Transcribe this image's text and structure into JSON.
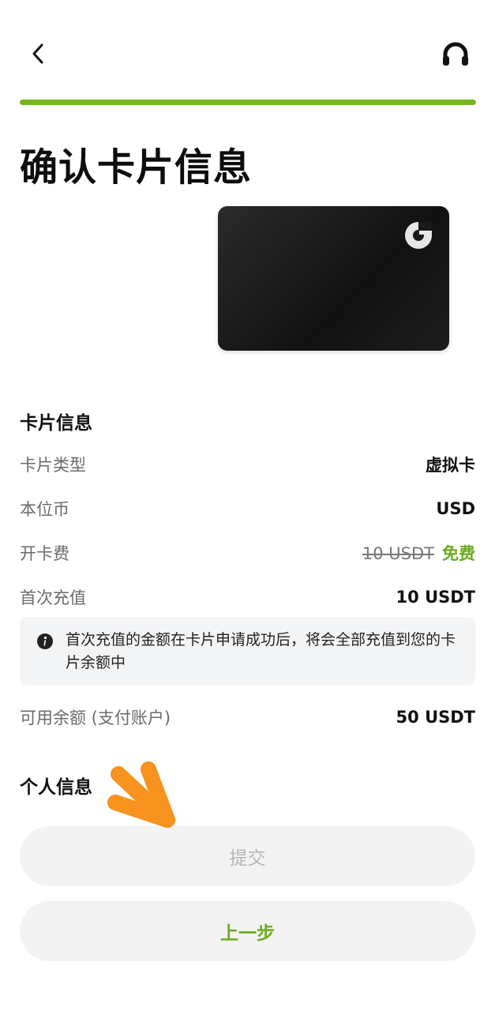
{
  "header": {
    "back_icon": "chevron-left-icon",
    "support_icon": "headset-icon"
  },
  "progress": {
    "value": 1.0,
    "color": "#74b71c"
  },
  "title": "确认卡片信息",
  "card": {
    "logo_icon": "brand-logo-icon",
    "color": "#1a1a1a"
  },
  "card_info": {
    "section_title": "卡片信息",
    "card_type": {
      "label": "卡片类型",
      "value": "虚拟卡"
    },
    "currency": {
      "label": "本位币",
      "value": "USD"
    },
    "fee": {
      "label": "开卡费",
      "original": "10 USDT",
      "current": "免费"
    },
    "first_topup": {
      "label": "首次充值",
      "value": "10 USDT"
    },
    "notice": "首次充值的金额在卡片申请成功后，将会全部充值到您的卡片余额中",
    "balance": {
      "label": "可用余额 (支付账户)",
      "value": "50 USDT"
    }
  },
  "personal_info": {
    "section_title": "个人信息"
  },
  "buttons": {
    "submit": "提交",
    "previous": "上一步"
  },
  "colors": {
    "accent": "#6aab1c",
    "annotation_arrow": "#f7931e"
  }
}
